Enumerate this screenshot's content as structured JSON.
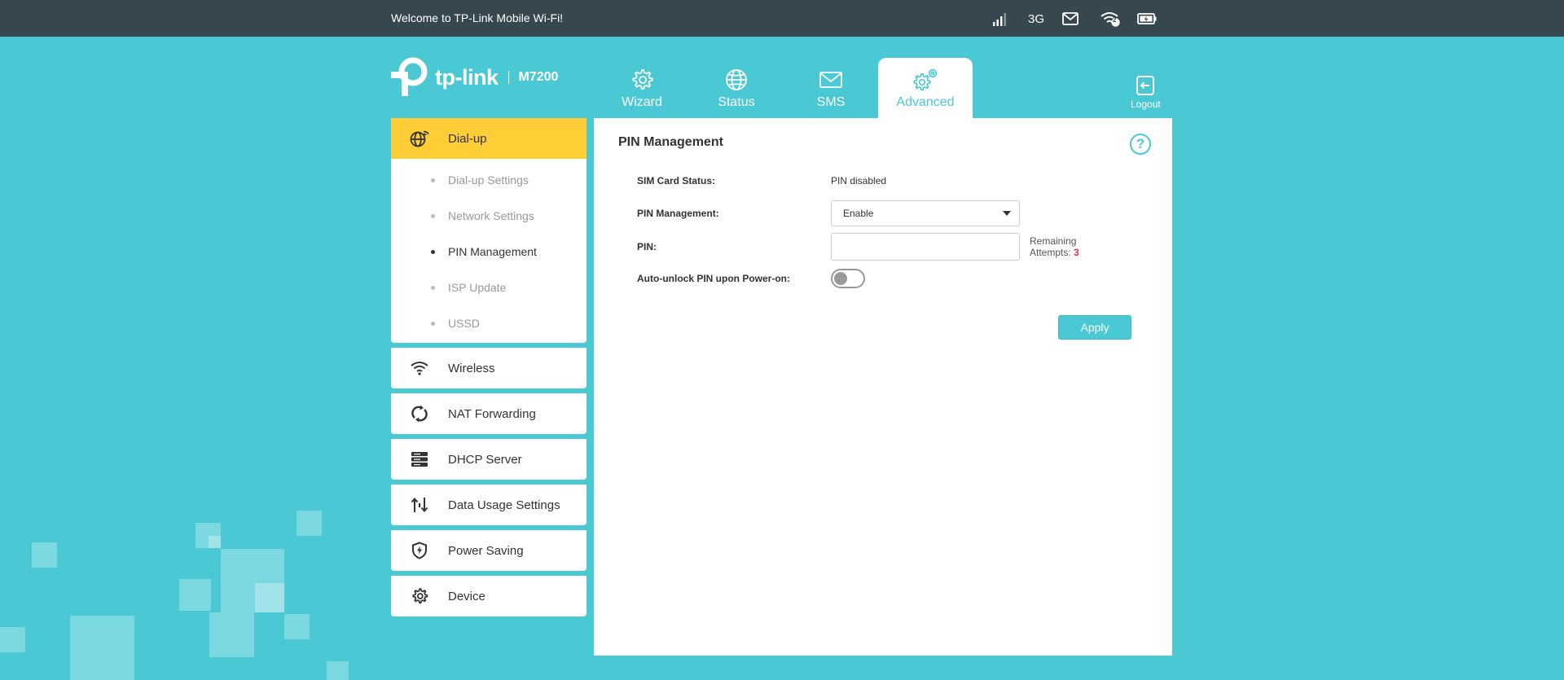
{
  "topbar": {
    "welcome": "Welcome to TP-Link Mobile Wi-Fi!",
    "network_type": "3G",
    "wifi_clients": "2"
  },
  "brand": {
    "logo_text": "tp-link",
    "model": "M7200"
  },
  "tabs": [
    {
      "label": "Wizard",
      "icon": "gear-icon",
      "active": false
    },
    {
      "label": "Status",
      "icon": "globe-icon",
      "active": false
    },
    {
      "label": "SMS",
      "icon": "envelope-icon",
      "active": false
    },
    {
      "label": "Advanced",
      "icon": "gears-icon",
      "active": true
    }
  ],
  "logout": {
    "label": "Logout"
  },
  "sidebar": {
    "items": [
      {
        "label": "Dial-up",
        "icon": "globe-wifi-icon",
        "active": true,
        "sub_items": [
          {
            "label": "Dial-up Settings"
          },
          {
            "label": "Network Settings"
          },
          {
            "label": "PIN Management"
          },
          {
            "label": "ISP Update"
          },
          {
            "label": "USSD"
          }
        ]
      },
      {
        "label": "Wireless",
        "icon": "wifi-icon"
      },
      {
        "label": "NAT Forwarding",
        "icon": "nat-icon"
      },
      {
        "label": "DHCP Server",
        "icon": "server-icon"
      },
      {
        "label": "Data Usage Settings",
        "icon": "arrows-updown-icon"
      },
      {
        "label": "Power Saving",
        "icon": "shield-bolt-icon"
      },
      {
        "label": "Device",
        "icon": "gear-icon"
      }
    ]
  },
  "panel": {
    "title": "PIN Management",
    "sim_status_label": "SIM Card Status:",
    "sim_status_value": "PIN disabled",
    "pin_mgmt_label": "PIN Management:",
    "pin_mgmt_value": "Enable",
    "pin_label": "PIN:",
    "pin_value": "",
    "remaining_label": "Remaining",
    "attempts_label": "Attempts:",
    "attempts_count": "3",
    "auto_unlock_label": "Auto-unlock PIN upon Power-on:",
    "auto_unlock_on": false,
    "apply_label": "Apply"
  },
  "colors": {
    "accent": "#4ac9d5",
    "topbar": "#37474f",
    "active_nav": "#ffcd36",
    "attempts": "#e0354c"
  }
}
